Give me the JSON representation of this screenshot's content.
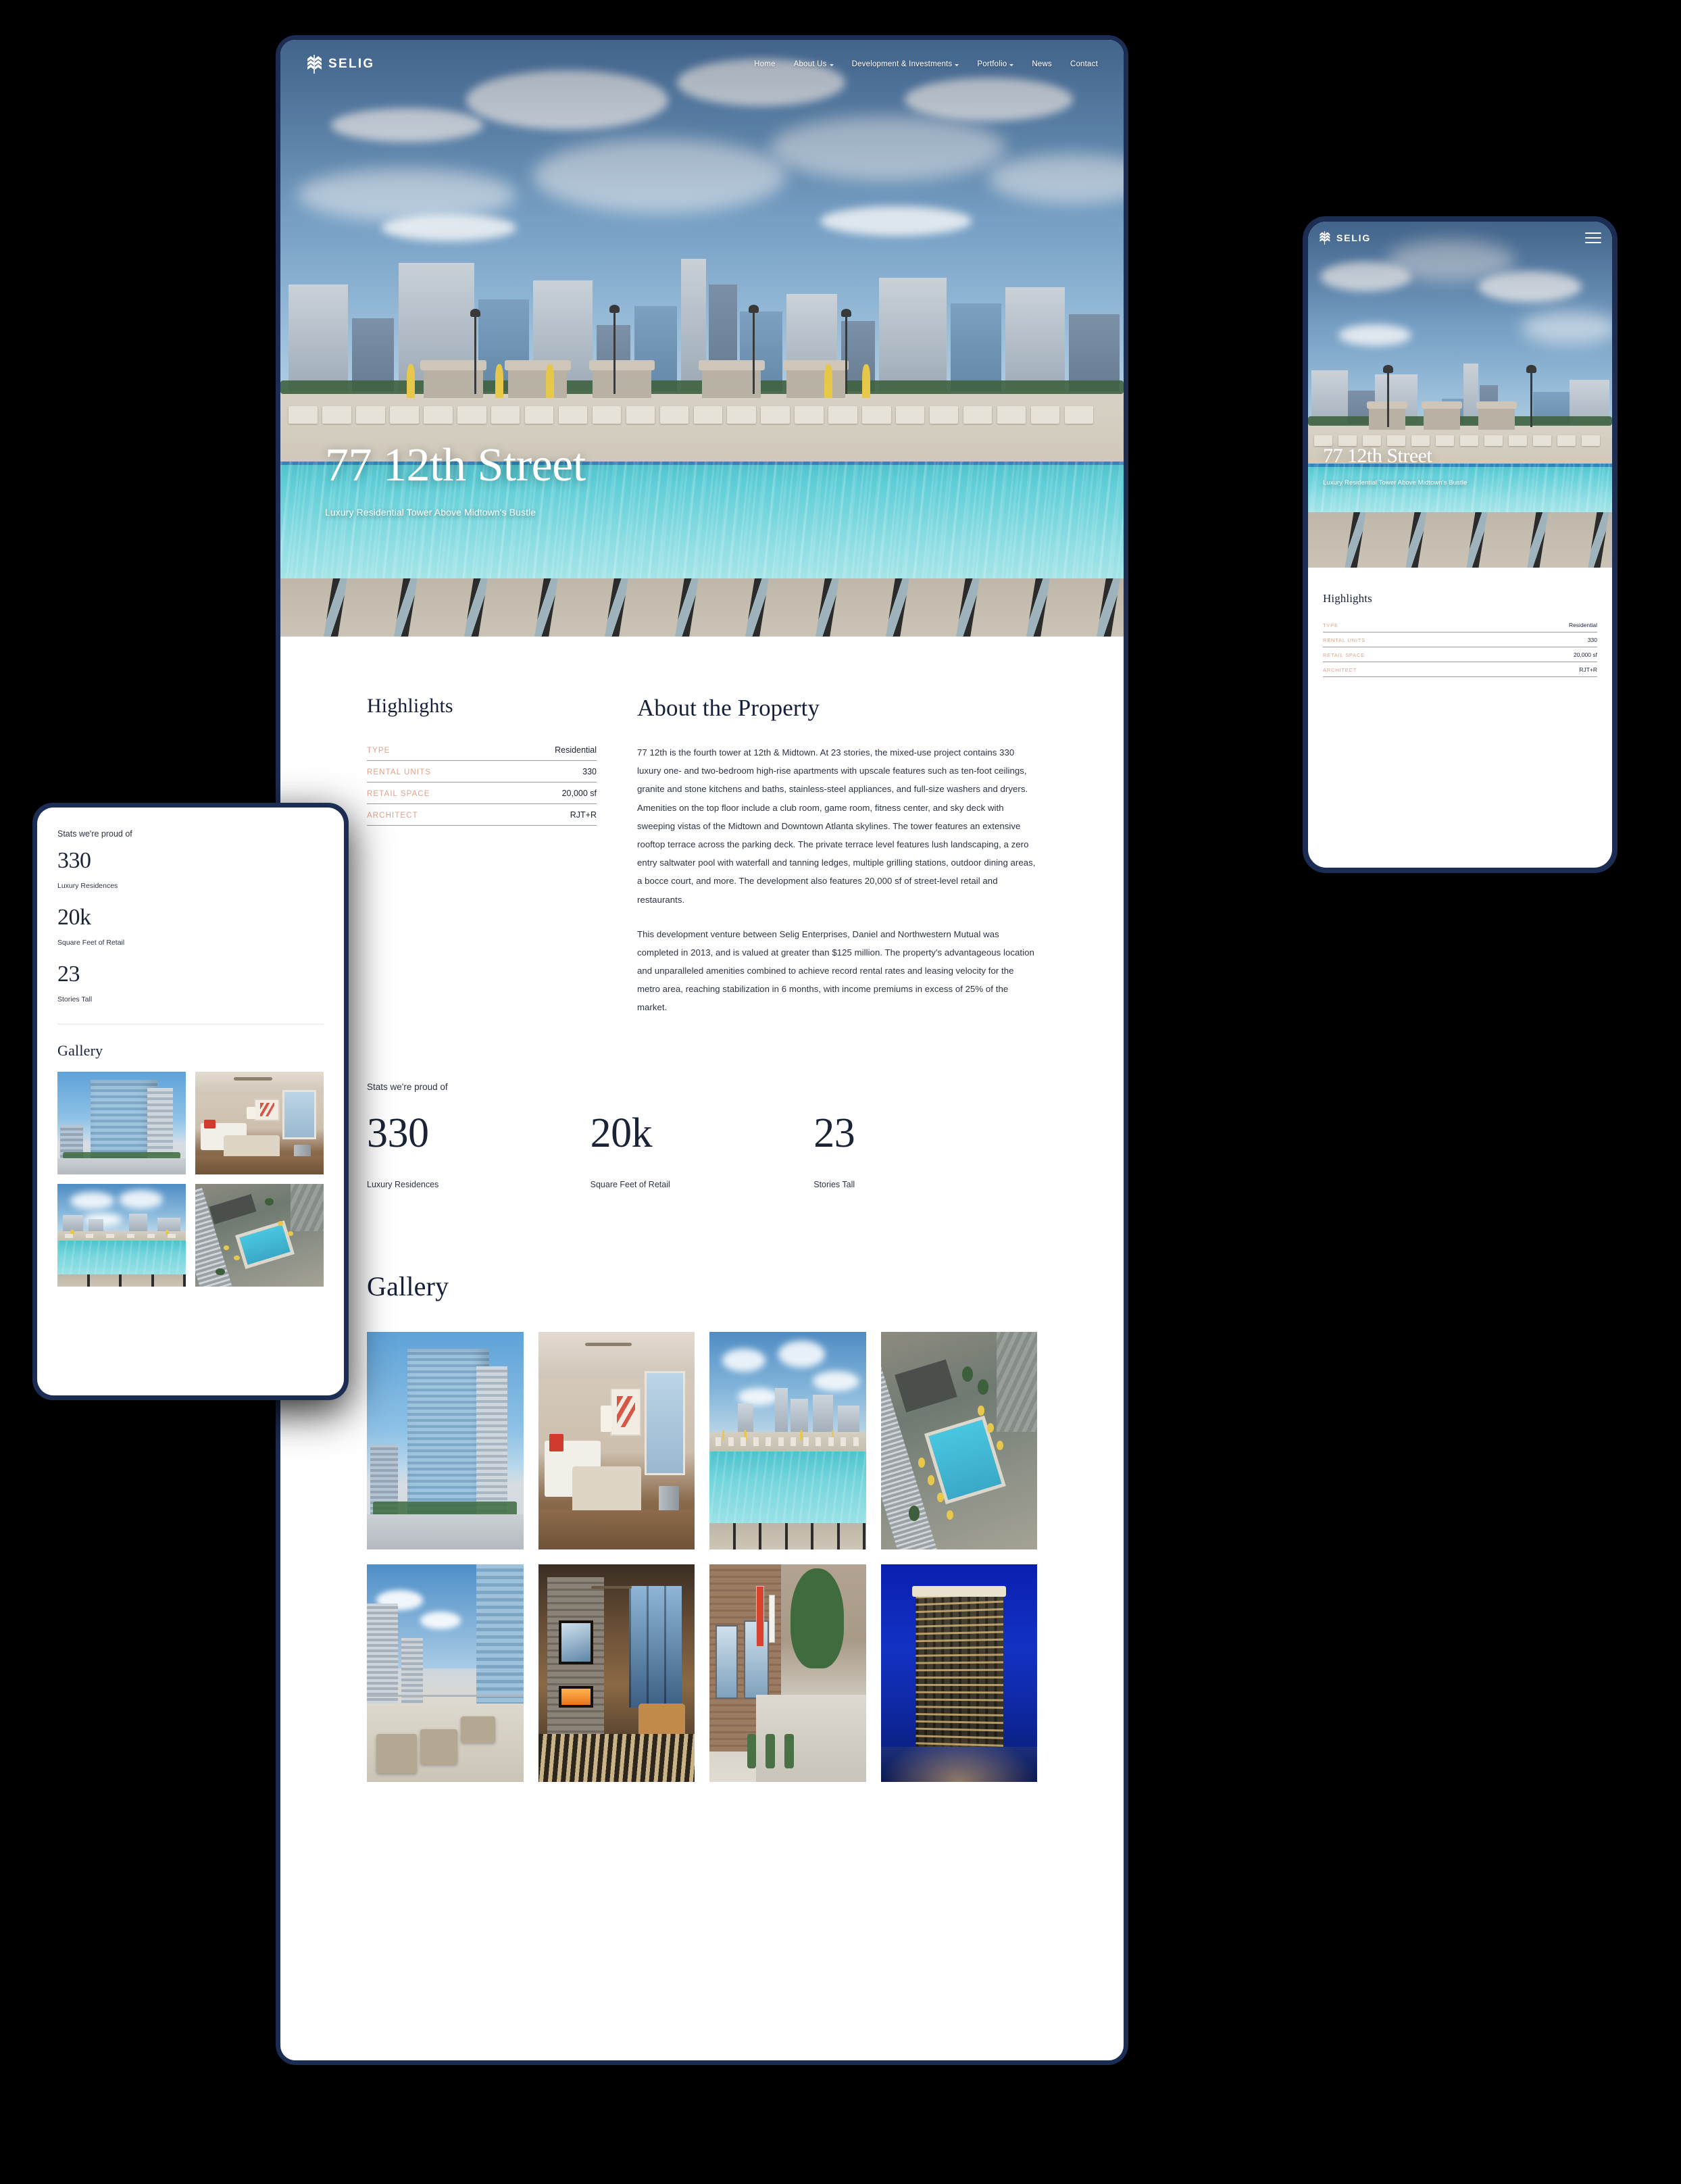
{
  "brand": {
    "name": "SELIG",
    "logo_icon": "selig-chevron-building-logo"
  },
  "nav": {
    "items": [
      {
        "label": "Home",
        "has_dropdown": false
      },
      {
        "label": "About Us",
        "has_dropdown": true
      },
      {
        "label": "Development & Investments",
        "has_dropdown": true
      },
      {
        "label": "Portfolio",
        "has_dropdown": true
      },
      {
        "label": "News",
        "has_dropdown": false
      },
      {
        "label": "Contact",
        "has_dropdown": false
      }
    ],
    "mobile_menu_icon": "hamburger-menu-icon"
  },
  "hero": {
    "title": "77 12th Street",
    "subtitle": "Luxury Residential Tower Above Midtown's Bustle",
    "image_alt": "rooftop-pool-with-midtown-atlanta-skyline"
  },
  "highlights": {
    "heading": "Highlights",
    "rows": [
      {
        "label": "TYPE",
        "value": "Residential"
      },
      {
        "label": "RENTAL UNITS",
        "value": "330"
      },
      {
        "label": "RETAIL SPACE",
        "value": "20,000 sf"
      },
      {
        "label": "ARCHITECT",
        "value": "RJT+R"
      }
    ]
  },
  "about": {
    "heading": "About the Property",
    "paragraphs": [
      "77 12th is the fourth tower at 12th & Midtown. At 23 stories, the mixed-use project contains 330 luxury one- and two-bedroom high-rise apartments with upscale features such as ten-foot ceilings, granite and stone kitchens and baths, stainless-steel appliances, and full-size washers and dryers. Amenities on the top floor include a club room, game room, fitness center, and sky deck with sweeping vistas of the Midtown and Downtown Atlanta skylines. The tower features an extensive rooftop terrace across the parking deck. The private terrace level features lush landscaping, a zero entry saltwater pool with waterfall and tanning ledges, multiple grilling stations, outdoor dining areas, a bocce court, and more. The development also features 20,000 sf of street-level retail and restaurants.",
      "This development venture between Selig Enterprises, Daniel and Northwestern Mutual was completed in 2013, and is valued at greater than $125 million. The property's advantageous location and unparalleled amenities combined to achieve record rental rates and leasing velocity for the metro area, reaching stabilization in 6 months, with income premiums in excess of 25% of the market."
    ]
  },
  "stats": {
    "kicker": "Stats we're proud of",
    "items": [
      {
        "number": "330",
        "label": "Luxury Residences"
      },
      {
        "number": "20k",
        "label": "Square Feet of Retail"
      },
      {
        "number": "23",
        "label": "Stories Tall"
      }
    ]
  },
  "gallery": {
    "heading": "Gallery",
    "images": [
      {
        "alt": "glass-tower-exterior-daytime"
      },
      {
        "alt": "furnished-apartment-living-room"
      },
      {
        "alt": "rooftop-pool-and-skyline"
      },
      {
        "alt": "aerial-view-of-pool-deck"
      },
      {
        "alt": "balcony-terrace-seating"
      },
      {
        "alt": "fireplace-lounge-with-city-view"
      },
      {
        "alt": "street-level-retail-sidewalk"
      },
      {
        "alt": "tower-exterior-at-night"
      }
    ]
  },
  "colors": {
    "brand_navy": "#1b2d52",
    "accent_salmon": "#dfa18c",
    "heading_ink": "#17203a",
    "body_ink": "#2b3245",
    "page_background": "#000000"
  }
}
